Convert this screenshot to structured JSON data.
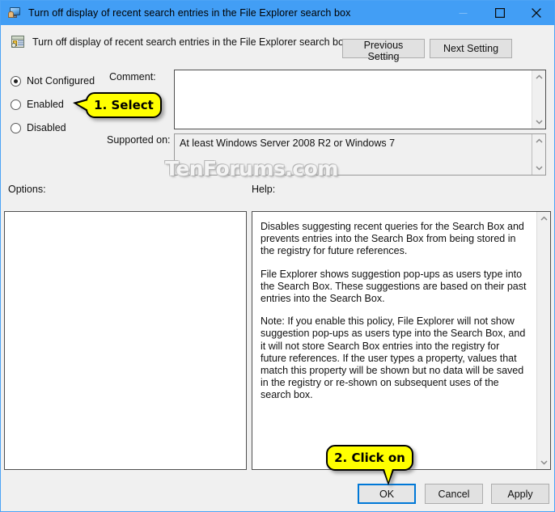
{
  "window": {
    "title": "Turn off display of recent search entries in the File Explorer search box",
    "title_icon": "monitor-icon",
    "controls": {
      "minimize": "minimize-icon",
      "maximize": "maximize-icon",
      "close": "close-icon"
    }
  },
  "header": {
    "icon": "group-policy-setting-icon",
    "title": "Turn off display of recent search entries in the File Explorer search box",
    "previous_setting": "Previous Setting",
    "next_setting": "Next Setting"
  },
  "state_options": [
    {
      "label": "Not Configured",
      "selected": true
    },
    {
      "label": "Enabled",
      "selected": false
    },
    {
      "label": "Disabled",
      "selected": false
    }
  ],
  "comment": {
    "label": "Comment:",
    "value": "",
    "placeholder": ""
  },
  "supported_on": {
    "label": "Supported on:",
    "value": "At least Windows Server 2008 R2 or Windows 7"
  },
  "options": {
    "label": "Options:",
    "value": ""
  },
  "help": {
    "label": "Help:",
    "paragraphs": [
      "Disables suggesting recent queries for the Search Box and prevents entries into the Search Box from being stored in the registry for future references.",
      "File Explorer shows suggestion pop-ups as users type into the Search Box.  These suggestions are based on their past entries into the Search Box.",
      "Note: If you enable this policy, File Explorer will not show suggestion pop-ups as users type into the Search Box, and it will not store Search Box entries into the registry for future references.  If the user types a property, values that match this property will be shown but no data will be saved in the registry or re-shown on subsequent uses of the search box."
    ]
  },
  "footer": {
    "ok": "OK",
    "cancel": "Cancel",
    "apply": "Apply"
  },
  "callouts": {
    "step1": "1. Select",
    "step2": "2. Click on"
  },
  "watermark": "TenForums.com",
  "colors": {
    "titlebar": "#429ef5",
    "window_border": "#4da3f5",
    "dialog_background": "#f0f0f0",
    "callout_fill": "#ffff00",
    "focus_border": "#0078d7"
  }
}
